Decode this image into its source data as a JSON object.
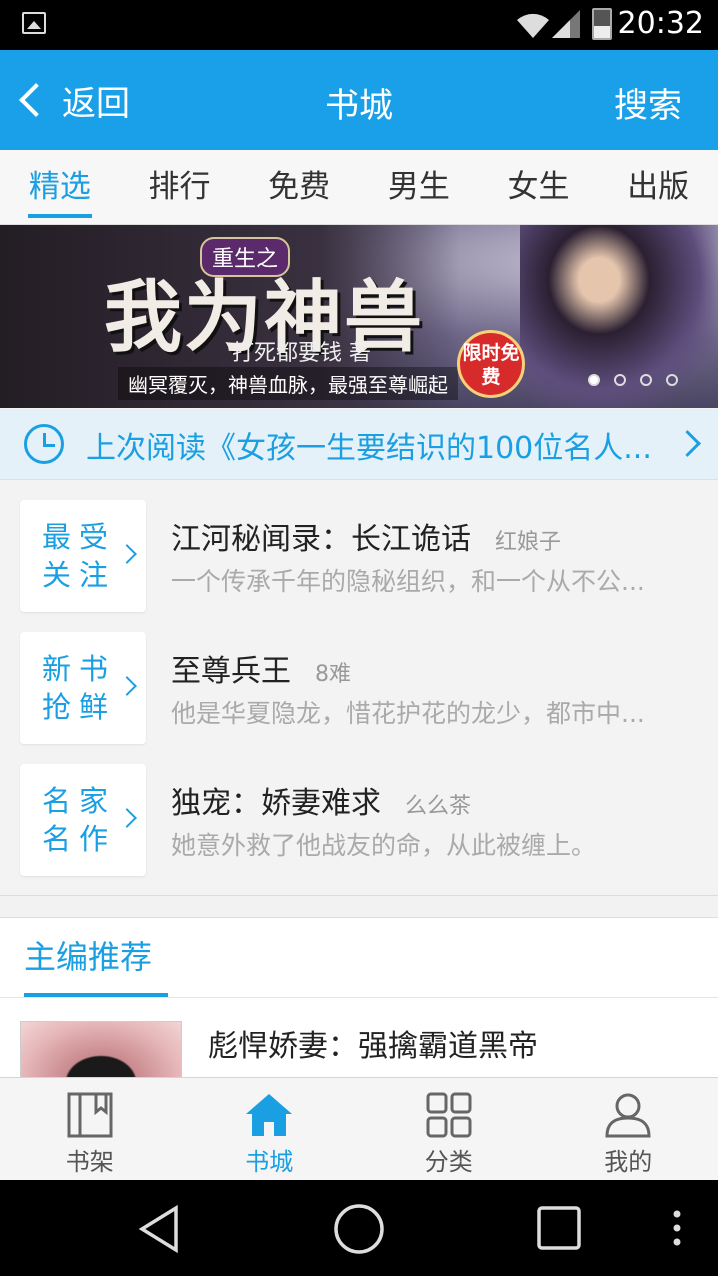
{
  "status_bar": {
    "time": "20:32"
  },
  "header": {
    "back_label": "返回",
    "title": "书城",
    "search_label": "搜索"
  },
  "tabs": [
    {
      "label": "精选",
      "active": true
    },
    {
      "label": "排行",
      "active": false
    },
    {
      "label": "免费",
      "active": false
    },
    {
      "label": "男生",
      "active": false
    },
    {
      "label": "女生",
      "active": false
    },
    {
      "label": "出版",
      "active": false
    }
  ],
  "banner": {
    "subtitle": "重生之",
    "title": "我为神兽",
    "author": "打死都要钱 著",
    "tagline": "幽冥覆灭，神兽血脉，最强至尊崛起",
    "badge": "限时免费",
    "slide_count": 4,
    "active_slide": 1
  },
  "last_read": {
    "text": "上次阅读《女孩一生要结识的100位名人..."
  },
  "recommendations": [
    {
      "label": "最受关注",
      "title": "江河秘闻录：长江诡话",
      "author": "红娘子",
      "desc": "一个传承千年的隐秘组织，和一个从不公..."
    },
    {
      "label": "新书抢鲜",
      "title": "至尊兵王",
      "author": "8难",
      "desc": "他是华夏隐龙，惜花护花的龙少，都市中..."
    },
    {
      "label": "名家名作",
      "title": "独宠：娇妻难求",
      "author": "么么茶",
      "desc": "她意外救了他战友的命，从此被缠上。"
    }
  ],
  "editor_pick": {
    "heading": "主编推荐",
    "book_title": "彪悍娇妻：强擒霸道黑帝"
  },
  "bottom_nav": [
    {
      "label": "书架",
      "icon": "bookshelf-icon",
      "active": false
    },
    {
      "label": "书城",
      "icon": "home-icon",
      "active": true
    },
    {
      "label": "分类",
      "icon": "grid-icon",
      "active": false
    },
    {
      "label": "我的",
      "icon": "user-icon",
      "active": false
    }
  ],
  "colors": {
    "accent": "#1a9fe3",
    "header": "#1aa0e8"
  }
}
